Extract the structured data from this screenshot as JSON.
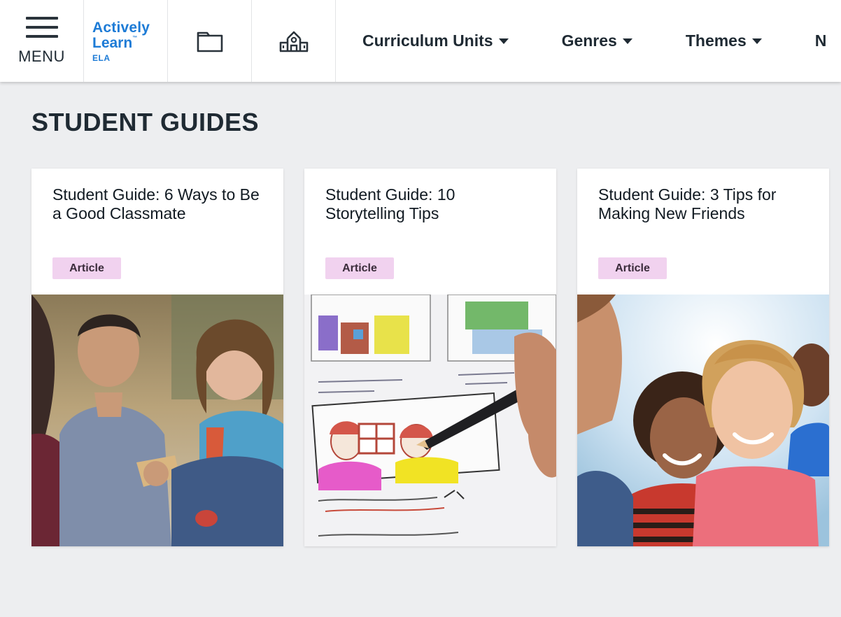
{
  "header": {
    "menu_label": "MENU",
    "logo": {
      "line1": "Actively",
      "line2": "Learn",
      "tm": "™",
      "line3": "ELA"
    },
    "icons": [
      "folder-icon",
      "school-icon"
    ],
    "nav": [
      {
        "label": "Curriculum Units"
      },
      {
        "label": "Genres"
      },
      {
        "label": "Themes"
      },
      {
        "label": "N"
      }
    ]
  },
  "page": {
    "title": "STUDENT GUIDES"
  },
  "cards": [
    {
      "title": "Student Guide: 6 Ways to Be a Good Classmate",
      "badge": "Article"
    },
    {
      "title": "Student Guide: 10 Storytelling Tips",
      "badge": "Article"
    },
    {
      "title": "Student Guide: 3 Tips for Making New Friends",
      "badge": "Article"
    }
  ],
  "colors": {
    "accent": "#1d7bd6",
    "badge_bg": "#f1d2ef",
    "background": "#edeef0",
    "text": "#1f2a33"
  }
}
